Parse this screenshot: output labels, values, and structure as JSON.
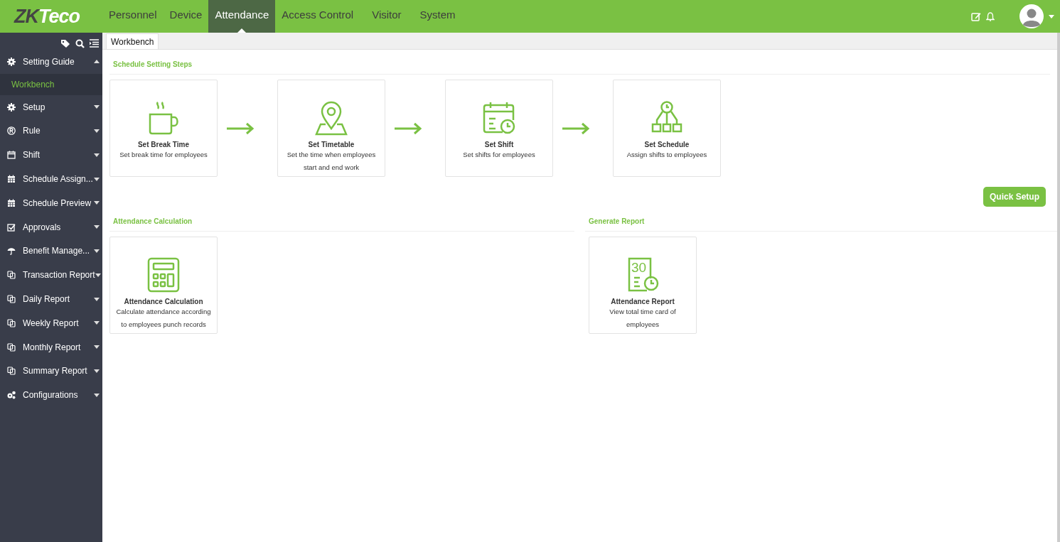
{
  "logo": {
    "dark": "ZK",
    "light": "Teco"
  },
  "nav": [
    {
      "label": "Personnel",
      "selected": false
    },
    {
      "label": "Device",
      "selected": false
    },
    {
      "label": "Attendance",
      "selected": true
    },
    {
      "label": "Access Control",
      "selected": false
    },
    {
      "label": "Visitor",
      "selected": false
    },
    {
      "label": "System",
      "selected": false
    }
  ],
  "sidebar": {
    "items": [
      {
        "label": "Setting Guide",
        "expanded": true,
        "children": [
          {
            "label": "Workbench",
            "selected": true
          }
        ]
      },
      {
        "label": "Setup",
        "expanded": false
      },
      {
        "label": "Rule",
        "expanded": false
      },
      {
        "label": "Shift",
        "expanded": false
      },
      {
        "label": "Schedule Assign...",
        "expanded": false
      },
      {
        "label": "Schedule Preview",
        "expanded": false
      },
      {
        "label": "Approvals",
        "expanded": false
      },
      {
        "label": "Benefit Manage...",
        "expanded": false
      },
      {
        "label": "Transaction Report",
        "expanded": false
      },
      {
        "label": "Daily Report",
        "expanded": false
      },
      {
        "label": "Weekly Report",
        "expanded": false
      },
      {
        "label": "Monthly Report",
        "expanded": false
      },
      {
        "label": "Summary Report",
        "expanded": false
      },
      {
        "label": "Configurations",
        "expanded": false
      }
    ]
  },
  "tabs": [
    {
      "label": "Workbench",
      "selected": true
    }
  ],
  "steps": {
    "title": "Schedule Setting Steps",
    "cards": [
      {
        "title": "Set Break Time",
        "lines": [
          "Set break time for employees"
        ]
      },
      {
        "title": "Set Timetable",
        "lines": [
          "Set the time when employees",
          "start and end work"
        ]
      },
      {
        "title": "Set Shift",
        "lines": [
          "Set shifts for employees"
        ]
      },
      {
        "title": "Set Schedule",
        "lines": [
          "Assign shifts to employees"
        ]
      }
    ],
    "button": "Quick Setup"
  },
  "sections": [
    {
      "title": "Attendance Calculation",
      "cards": [
        {
          "title": "Attendance Calculation",
          "lines": [
            "Calculate attendance according",
            "to employees punch records"
          ]
        }
      ]
    },
    {
      "title": "Generate Report",
      "cards": [
        {
          "title": "Attendance Report",
          "icon_text": "30",
          "lines": [
            "View total time card of",
            "employees"
          ]
        }
      ]
    }
  ]
}
